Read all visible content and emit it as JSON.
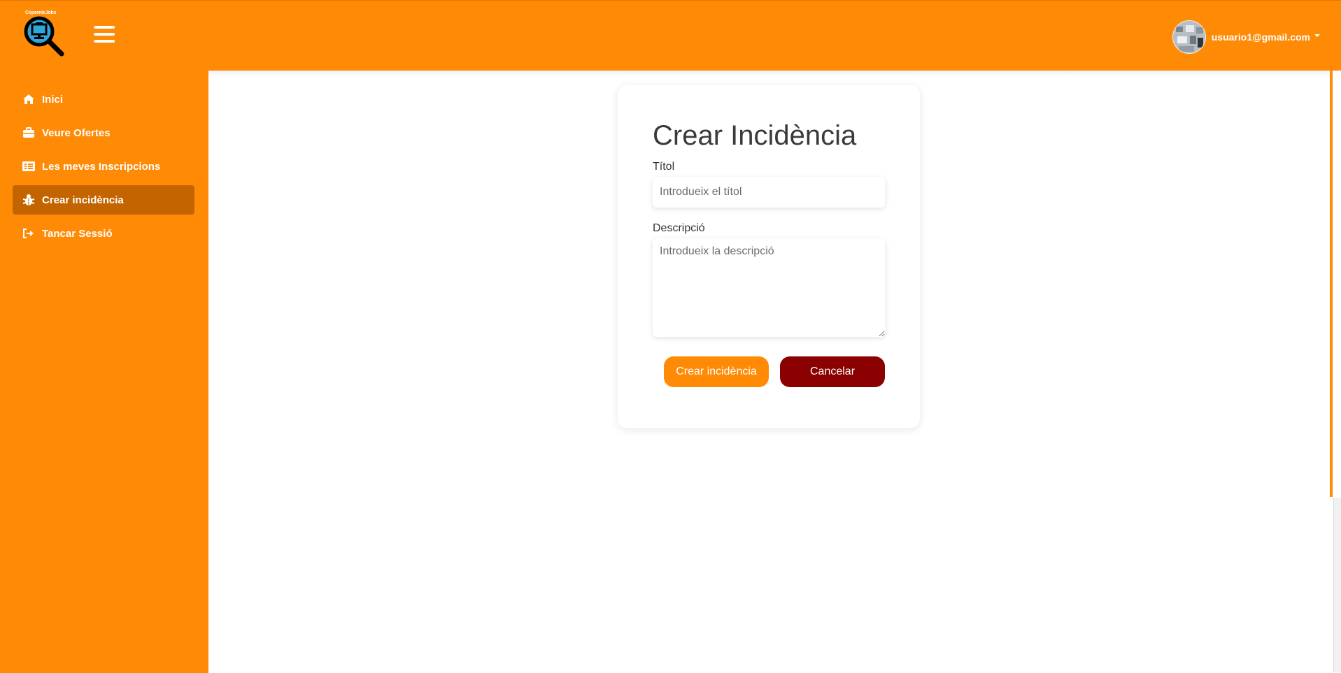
{
  "brand": {
    "logo_text": "CopernicJobs"
  },
  "header": {
    "menu_icon": "hamburger-icon",
    "user_email": "usuario1@gmail.com"
  },
  "sidebar": {
    "items": [
      {
        "label": "Inici",
        "icon": "home-icon",
        "active": false
      },
      {
        "label": "Veure Ofertes",
        "icon": "briefcase-icon",
        "active": false
      },
      {
        "label": "Les meves Inscripcions",
        "icon": "list-icon",
        "active": false
      },
      {
        "label": "Crear incidència",
        "icon": "bug-icon",
        "active": true
      },
      {
        "label": "Tancar Sessió",
        "icon": "sign-out-icon",
        "active": false
      }
    ]
  },
  "form": {
    "title": "Crear Incidència",
    "title_label": "Títol",
    "title_placeholder": "Introdueix el títol",
    "title_value": "",
    "description_label": "Descripció",
    "description_placeholder": "Introdueix la descripció",
    "description_value": "",
    "submit_label": "Crear incidència",
    "cancel_label": "Cancelar"
  },
  "colors": {
    "primary": "#ff8a05",
    "sidebar_active": "#c46400",
    "danger": "#8b0000"
  }
}
